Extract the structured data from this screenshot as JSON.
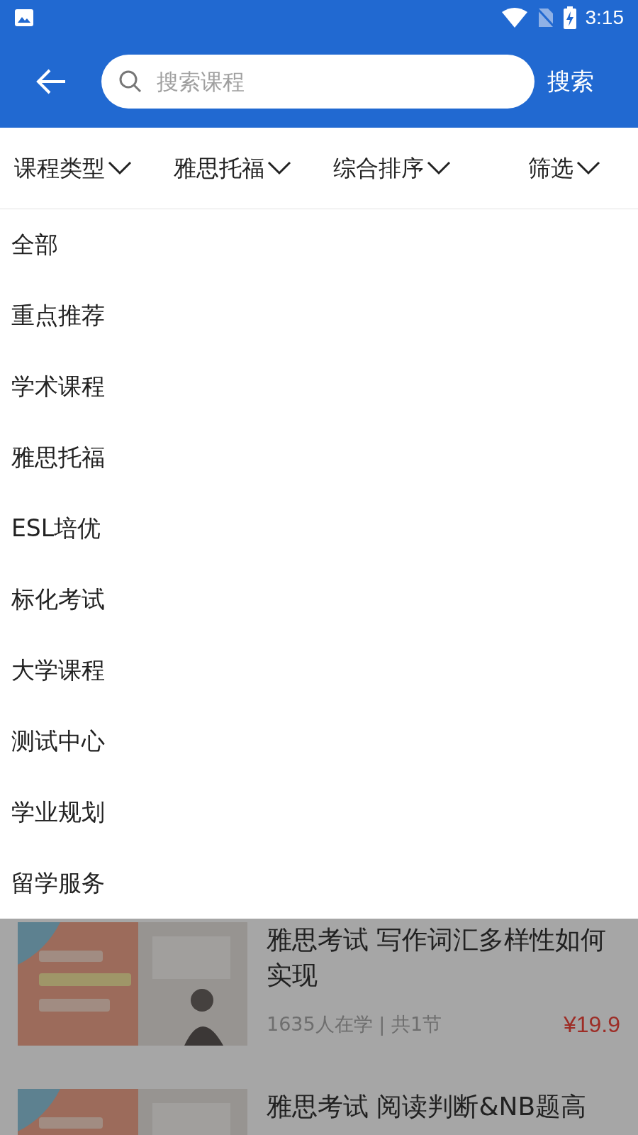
{
  "status_bar": {
    "time": "3:15"
  },
  "header": {
    "search": {
      "placeholder": "搜索课程"
    },
    "search_button": "搜索"
  },
  "filters": [
    {
      "label": "课程类型"
    },
    {
      "label": "雅思托福"
    },
    {
      "label": "综合排序"
    },
    {
      "label": "筛选"
    }
  ],
  "dropdown": {
    "items": [
      "全部",
      "重点推荐",
      "学术课程",
      "雅思托福",
      "ESL培优",
      "标化考试",
      "大学课程",
      "测试中心",
      "学业规划",
      "留学服务"
    ]
  },
  "courses": [
    {
      "title": "雅思考试 写作词汇多样性如何实现",
      "meta": "1635人在学 | 共1节",
      "price": "¥19.9"
    },
    {
      "title": "雅思考试 阅读判断&NB题高"
    }
  ]
}
